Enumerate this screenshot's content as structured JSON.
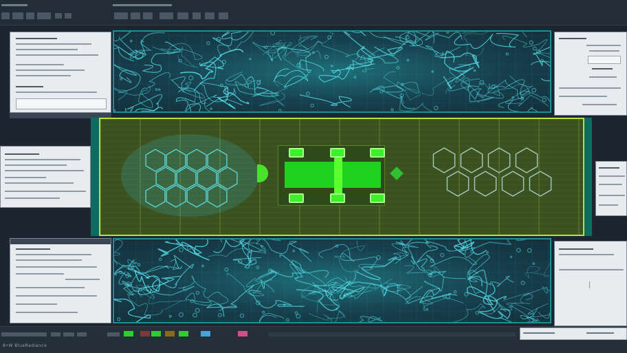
{
  "app": {
    "status_text": "8•W BlueRadiance"
  },
  "colors": {
    "background": "#1c2530",
    "circuit_cyan": "#58e6f0",
    "board_green": "#3b5220",
    "board_border": "#b7e43a",
    "chip_green": "#1fd21f",
    "teal_edge": "#0f6b62"
  },
  "status_swatches": [
    "#2ad12a",
    "#7a3a3a",
    "#2ad12a",
    "#8a6a1e",
    "#2ad12a",
    "#4aa2d8",
    "#d2508a"
  ]
}
